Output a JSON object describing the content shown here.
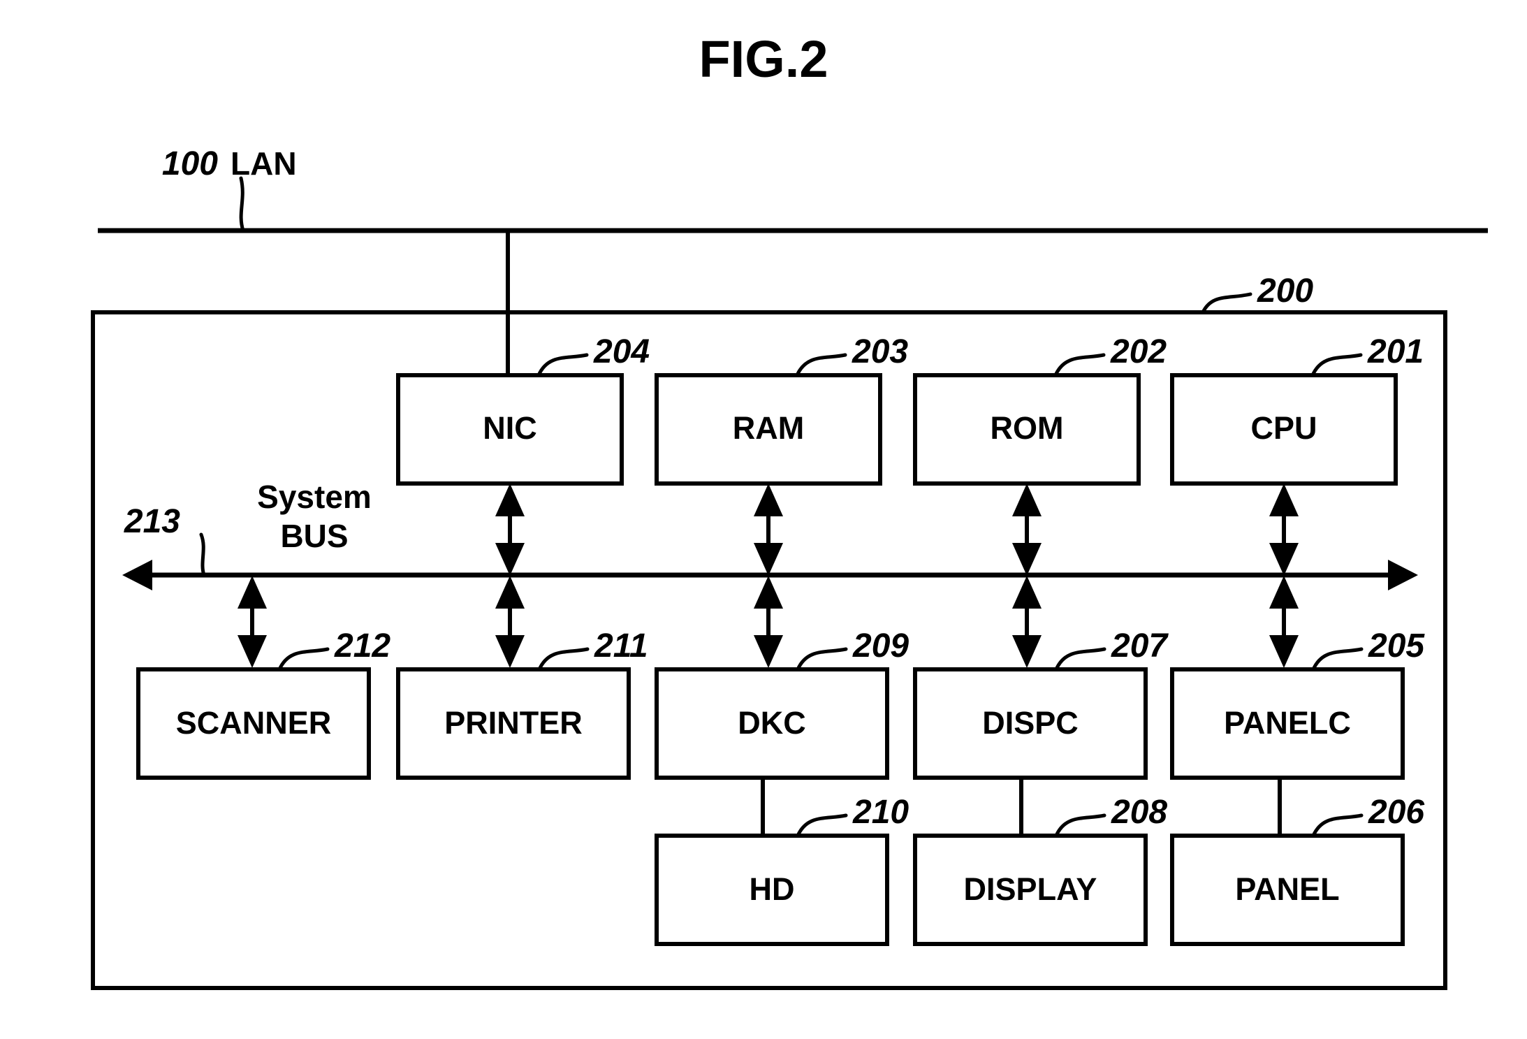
{
  "figure": {
    "title": "FIG.2",
    "network": {
      "ref": "100",
      "label": "LAN"
    },
    "system": {
      "ref": "200"
    },
    "bus": {
      "ref": "213",
      "label_line1": "System",
      "label_line2": "BUS"
    },
    "blocks": [
      {
        "id": "nic",
        "label": "NIC",
        "ref": "204"
      },
      {
        "id": "ram",
        "label": "RAM",
        "ref": "203"
      },
      {
        "id": "rom",
        "label": "ROM",
        "ref": "202"
      },
      {
        "id": "cpu",
        "label": "CPU",
        "ref": "201"
      },
      {
        "id": "scanner",
        "label": "SCANNER",
        "ref": "212"
      },
      {
        "id": "printer",
        "label": "PRINTER",
        "ref": "211"
      },
      {
        "id": "dkc",
        "label": "DKC",
        "ref": "209"
      },
      {
        "id": "dispc",
        "label": "DISPC",
        "ref": "207"
      },
      {
        "id": "panelc",
        "label": "PANELC",
        "ref": "205"
      },
      {
        "id": "hd",
        "label": "HD",
        "ref": "210"
      },
      {
        "id": "display",
        "label": "DISPLAY",
        "ref": "208"
      },
      {
        "id": "panel",
        "label": "PANEL",
        "ref": "206"
      }
    ],
    "colors": {
      "ink": "#000000",
      "paper": "#ffffff"
    }
  }
}
